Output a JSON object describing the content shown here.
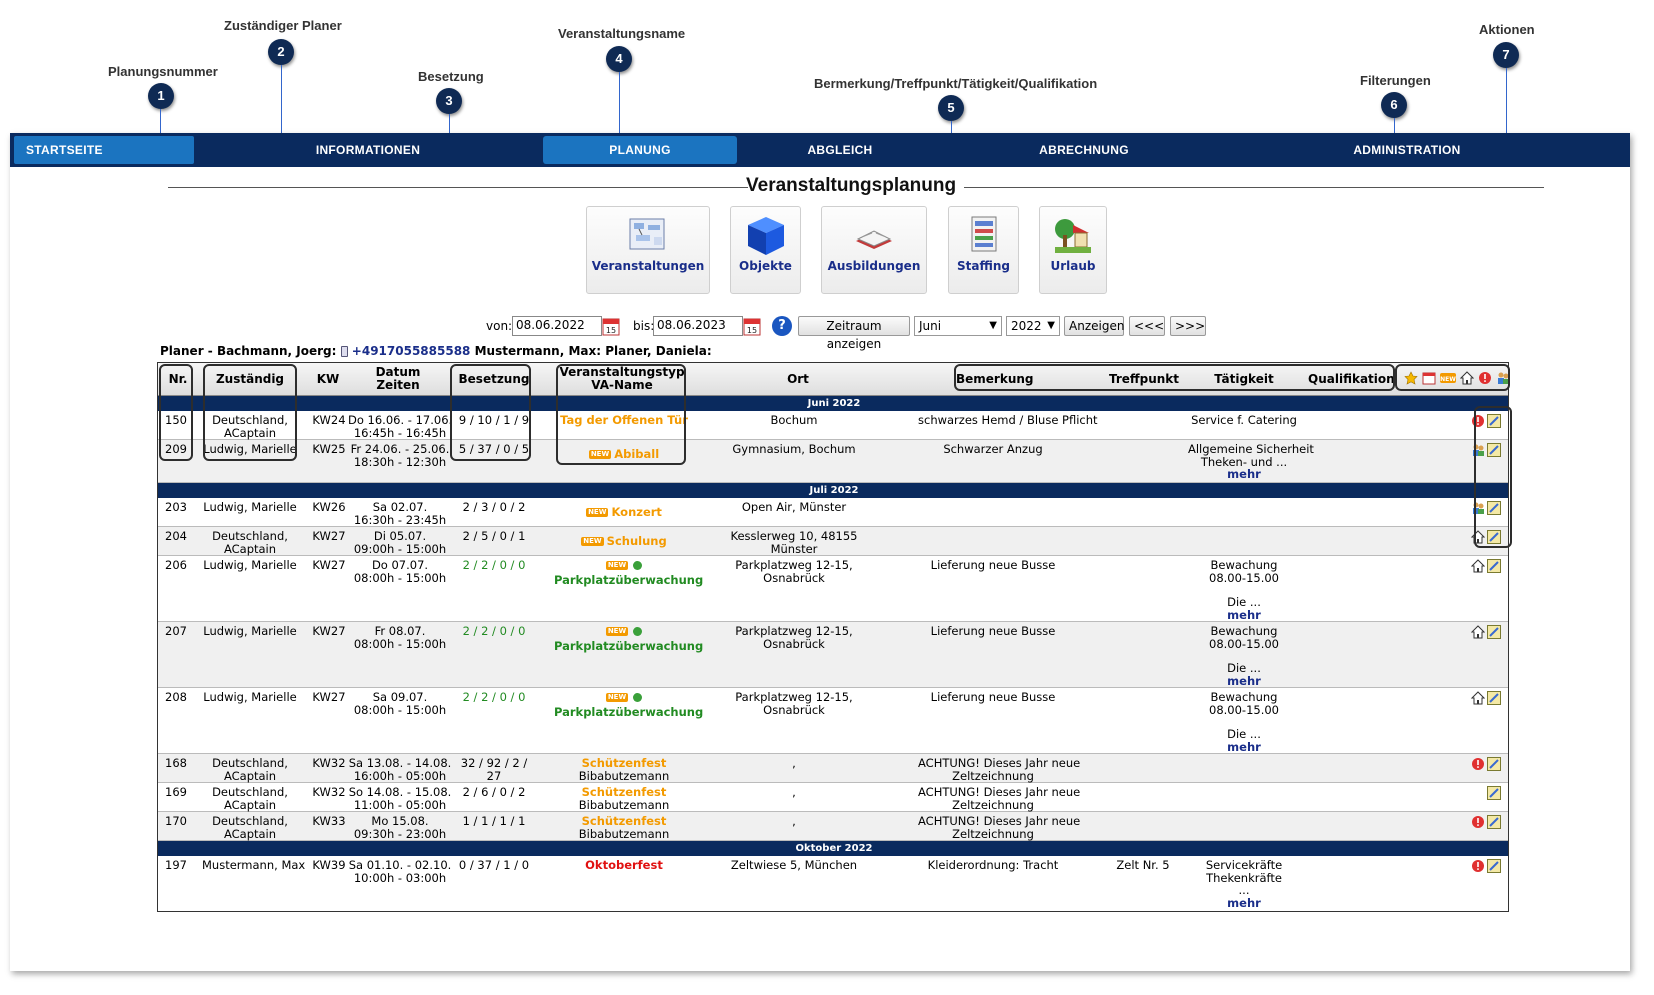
{
  "callouts": [
    {
      "num": "1",
      "label": "Planungsnummer"
    },
    {
      "num": "2",
      "label": "Zuständiger Planer"
    },
    {
      "num": "3",
      "label": "Besetzung"
    },
    {
      "num": "4",
      "label": "Veranstaltungsname"
    },
    {
      "num": "5",
      "label": "Bermerkung/Treffpunkt/Tätigkeit/Qualifikation"
    },
    {
      "num": "6",
      "label": "Filterungen"
    },
    {
      "num": "7",
      "label": "Aktionen"
    }
  ],
  "nav": {
    "items": [
      "STARTSEITE",
      "INFORMATIONEN",
      "PLANUNG",
      "ABGLEICH",
      "ABRECHNUNG",
      "ADMINISTRATION"
    ],
    "active": "PLANUNG"
  },
  "page_title": "Veranstaltungsplanung",
  "modules": [
    {
      "label": "Veranstaltungen",
      "icon": "event-planner-icon"
    },
    {
      "label": "Objekte",
      "icon": "cube-icon"
    },
    {
      "label": "Ausbildungen",
      "icon": "book-icon"
    },
    {
      "label": "Staffing",
      "icon": "staffing-icon"
    },
    {
      "label": "Urlaub",
      "icon": "vacation-icon"
    }
  ],
  "filter": {
    "von_label": "von:",
    "von_value": "08.06.2022",
    "bis_label": "bis:",
    "bis_value": "08.06.2023",
    "help": "?",
    "zeitraum_button": "Zeitraum anzeigen",
    "month_select": "Juni",
    "year_select": "2022",
    "anzeigen_button": "Anzeigen",
    "prev_button": "<<<",
    "next_button": ">>>"
  },
  "planer_line": {
    "prefix": "Planer - Bachmann, Joerg:",
    "phone": "+4917055885588",
    "rest": "Mustermann, Max:  Planer, Daniela:"
  },
  "table": {
    "headers": {
      "nr": "Nr.",
      "zustaendig": "Zuständig",
      "kw": "KW",
      "datum": "Datum",
      "zeiten": "Zeiten",
      "besetzung": "Besetzung",
      "va_typ": "Veranstaltungstyp",
      "va_name": "VA-Name",
      "ort": "Ort",
      "bemerkung": "Bemerkung",
      "treffpunkt": "Treffpunkt",
      "taetigkeit": "Tätigkeit",
      "qualifikation": "Qualifikation"
    },
    "months": [
      "Juni 2022",
      "Juli 2022",
      "Oktober 2022"
    ],
    "rows": [
      {
        "nr": "150",
        "z1": "Deutschland,",
        "z2": "ACaptain",
        "kw": "KW24",
        "d1": "Do 16.06. - 17.06.",
        "d2": "16:45h - 16:45h",
        "bes": "9 / 10 / 1 / 9",
        "va1": "",
        "va2": "Tag der Offenen Tür",
        "ort1": "Bochum",
        "ort2": "",
        "bem1": "schwarzes Hemd / Bluse Pflicht",
        "bem2": "",
        "treff": "",
        "t1": "Service f. Catering",
        "t2": "",
        "t3": "",
        "mehr": ""
      },
      {
        "nr": "209",
        "z1": "Ludwig, Marielle",
        "z2": "",
        "kw": "KW25",
        "d1": "Fr 24.06. - 25.06.",
        "d2": "18:30h - 12:30h",
        "bes": "5 / 37 / 0 / 5",
        "va1": "",
        "va2": "Abiball",
        "ort1": "Gymnasium, Bochum",
        "ort2": "",
        "bem1": "Schwarzer Anzug",
        "bem2": "",
        "treff": "",
        "t1": "Allgemeine Sicherheit",
        "t2": "Theken- und ...",
        "t3": "",
        "mehr": "mehr"
      },
      {
        "nr": "203",
        "z1": "Ludwig, Marielle",
        "z2": "",
        "kw": "KW26",
        "d1": "Sa 02.07.",
        "d2": "16:30h - 23:45h",
        "bes": "2 / 3 / 0 / 2",
        "va1": "",
        "va2": "Konzert",
        "ort1": "Open Air, Münster",
        "ort2": "",
        "bem1": "",
        "bem2": "",
        "treff": "",
        "t1": "",
        "t2": "",
        "t3": "",
        "mehr": ""
      },
      {
        "nr": "204",
        "z1": "Deutschland,",
        "z2": "ACaptain",
        "kw": "KW27",
        "d1": "Di 05.07.",
        "d2": "09:00h - 15:00h",
        "bes": "2 / 5 / 0 / 1",
        "va1": "",
        "va2": "Schulung",
        "ort1": "Kesslerweg 10, 48155",
        "ort2": "Münster",
        "bem1": "",
        "bem2": "",
        "treff": "",
        "t1": "",
        "t2": "",
        "t3": "",
        "mehr": ""
      },
      {
        "nr": "206",
        "z1": "Ludwig, Marielle",
        "z2": "",
        "kw": "KW27",
        "d1": "Do 07.07.",
        "d2": "08:00h - 15:00h",
        "bes": "2 / 2 / 0 / 0",
        "va1": "",
        "va2": "Parkplatzüberwachung",
        "ort1": "Parkplatzweg 12-15,",
        "ort2": "Osnabrück",
        "bem1": "Lieferung neue Busse",
        "bem2": "",
        "treff": "",
        "t1": "Bewachung",
        "t2": "08.00-15.00",
        "t3": "Die ...",
        "mehr": "mehr"
      },
      {
        "nr": "207",
        "z1": "Ludwig, Marielle",
        "z2": "",
        "kw": "KW27",
        "d1": "Fr 08.07.",
        "d2": "08:00h - 15:00h",
        "bes": "2 / 2 / 0 / 0",
        "va1": "",
        "va2": "Parkplatzüberwachung",
        "ort1": "Parkplatzweg 12-15,",
        "ort2": "Osnabrück",
        "bem1": "Lieferung neue Busse",
        "bem2": "",
        "treff": "",
        "t1": "Bewachung",
        "t2": "08.00-15.00",
        "t3": "Die ...",
        "mehr": "mehr"
      },
      {
        "nr": "208",
        "z1": "Ludwig, Marielle",
        "z2": "",
        "kw": "KW27",
        "d1": "Sa 09.07.",
        "d2": "08:00h - 15:00h",
        "bes": "2 / 2 / 0 / 0",
        "va1": "",
        "va2": "Parkplatzüberwachung",
        "ort1": "Parkplatzweg 12-15,",
        "ort2": "Osnabrück",
        "bem1": "Lieferung neue Busse",
        "bem2": "",
        "treff": "",
        "t1": "Bewachung",
        "t2": "08.00-15.00",
        "t3": "Die ...",
        "mehr": "mehr"
      },
      {
        "nr": "168",
        "z1": "Deutschland,",
        "z2": "ACaptain",
        "kw": "KW32",
        "d1": "Sa 13.08. - 14.08.",
        "d2": "16:00h - 05:00h",
        "bes": "32 / 92 / 2 /",
        "bes2": "27",
        "va1": "Schützenfest",
        "va2": "Bibabutzemann",
        "ort1": ",",
        "ort2": "",
        "bem1": "ACHTUNG! Dieses Jahr neue",
        "bem2": "Zeltzeichnung",
        "treff": "",
        "t1": "",
        "t2": "",
        "t3": "",
        "mehr": ""
      },
      {
        "nr": "169",
        "z1": "Deutschland,",
        "z2": "ACaptain",
        "kw": "KW32",
        "d1": "So 14.08. - 15.08.",
        "d2": "11:00h - 05:00h",
        "bes": "2 / 6 / 0 / 2",
        "va1": "Schützenfest",
        "va2": "Bibabutzemann",
        "ort1": ",",
        "ort2": "",
        "bem1": "ACHTUNG! Dieses Jahr neue",
        "bem2": "Zeltzeichnung",
        "treff": "",
        "t1": "",
        "t2": "",
        "t3": "",
        "mehr": ""
      },
      {
        "nr": "170",
        "z1": "Deutschland,",
        "z2": "ACaptain",
        "kw": "KW33",
        "d1": "Mo 15.08.",
        "d2": "09:30h - 23:00h",
        "bes": "1 / 1 / 1 / 1",
        "va1": "Schützenfest",
        "va2": "Bibabutzemann",
        "ort1": ",",
        "ort2": "",
        "bem1": "ACHTUNG! Dieses Jahr neue",
        "bem2": "Zeltzeichnung",
        "treff": "",
        "t1": "",
        "t2": "",
        "t3": "",
        "mehr": ""
      },
      {
        "nr": "197",
        "z1": "Mustermann, Max",
        "z2": "",
        "kw": "KW39",
        "d1": "Sa 01.10. - 02.10.",
        "d2": "10:00h - 03:00h",
        "bes": "0 / 37 / 1 / 0",
        "va1": "",
        "va2": "Oktoberfest",
        "ort1": "Zeltwiese 5, München",
        "ort2": "",
        "bem1": "Kleiderordnung: Tracht",
        "bem2": "",
        "treff": "Zelt Nr. 5",
        "t1": "Servicekräfte",
        "t2": "Thekenkräfte",
        "t3": "...",
        "mehr": "mehr"
      }
    ]
  },
  "colors": {
    "nav": "#0a2a5e",
    "active": "#1b74c0",
    "orange": "#f39a00",
    "green": "#228b22",
    "red": "#e01010",
    "link": "#1a2e8a"
  }
}
